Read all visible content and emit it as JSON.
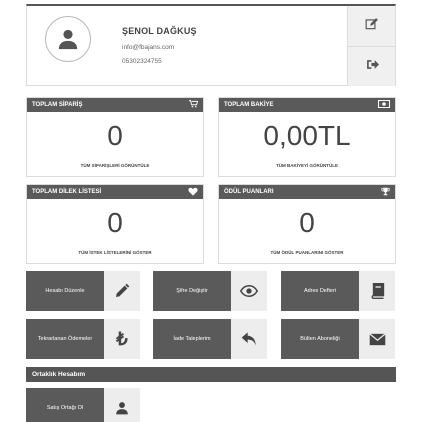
{
  "profile": {
    "name": "ŞENOL DAĞKUŞ",
    "email": "info@fbajans.com",
    "phone": "05302324755",
    "avatar_icon": "user-icon",
    "edit_icon": "edit-icon",
    "logout_icon": "sign-out-icon"
  },
  "stats": [
    {
      "title": "TOPLAM SİPARİŞ",
      "value": "0",
      "link": "TÜM SİPARİŞLERİ GÖRÜNTÜLE",
      "icon": "cart-icon"
    },
    {
      "title": "TOPLAM BAKİYE",
      "value": "0,00TL",
      "link": "TÜM BAKİYEYİ GÖRÜNTÜLE",
      "icon": "money-icon"
    },
    {
      "title": "TOPLAM DİLEK LİSTESİ",
      "value": "0",
      "link": "TÜM İSTEK LİSTELERİNİ GÖSTER",
      "icon": "heart-icon"
    },
    {
      "title": "ÖDÜL PUANLARI",
      "value": "0",
      "link": "TÜM ÖDÜL PUANLARINI GÖSTER",
      "icon": "trophy-icon"
    }
  ],
  "tiles": [
    {
      "label": "Hesabı Düzenle",
      "icon": "pencil-icon"
    },
    {
      "label": "Şifre Değiştir",
      "icon": "eye-icon"
    },
    {
      "label": "Adres Defteri",
      "icon": "book-icon"
    },
    {
      "label": "Tekrarlanan Ödemeler",
      "icon": "lira-icon"
    },
    {
      "label": "İade Taleplerim",
      "icon": "reply-icon"
    },
    {
      "label": "Bülten Aboneliği",
      "icon": "envelope-icon"
    }
  ],
  "affiliate": {
    "section_title": "Ortaklık Hesabım",
    "tile_label": "Satış Ortağı Ol",
    "tile_icon": "user-icon"
  }
}
